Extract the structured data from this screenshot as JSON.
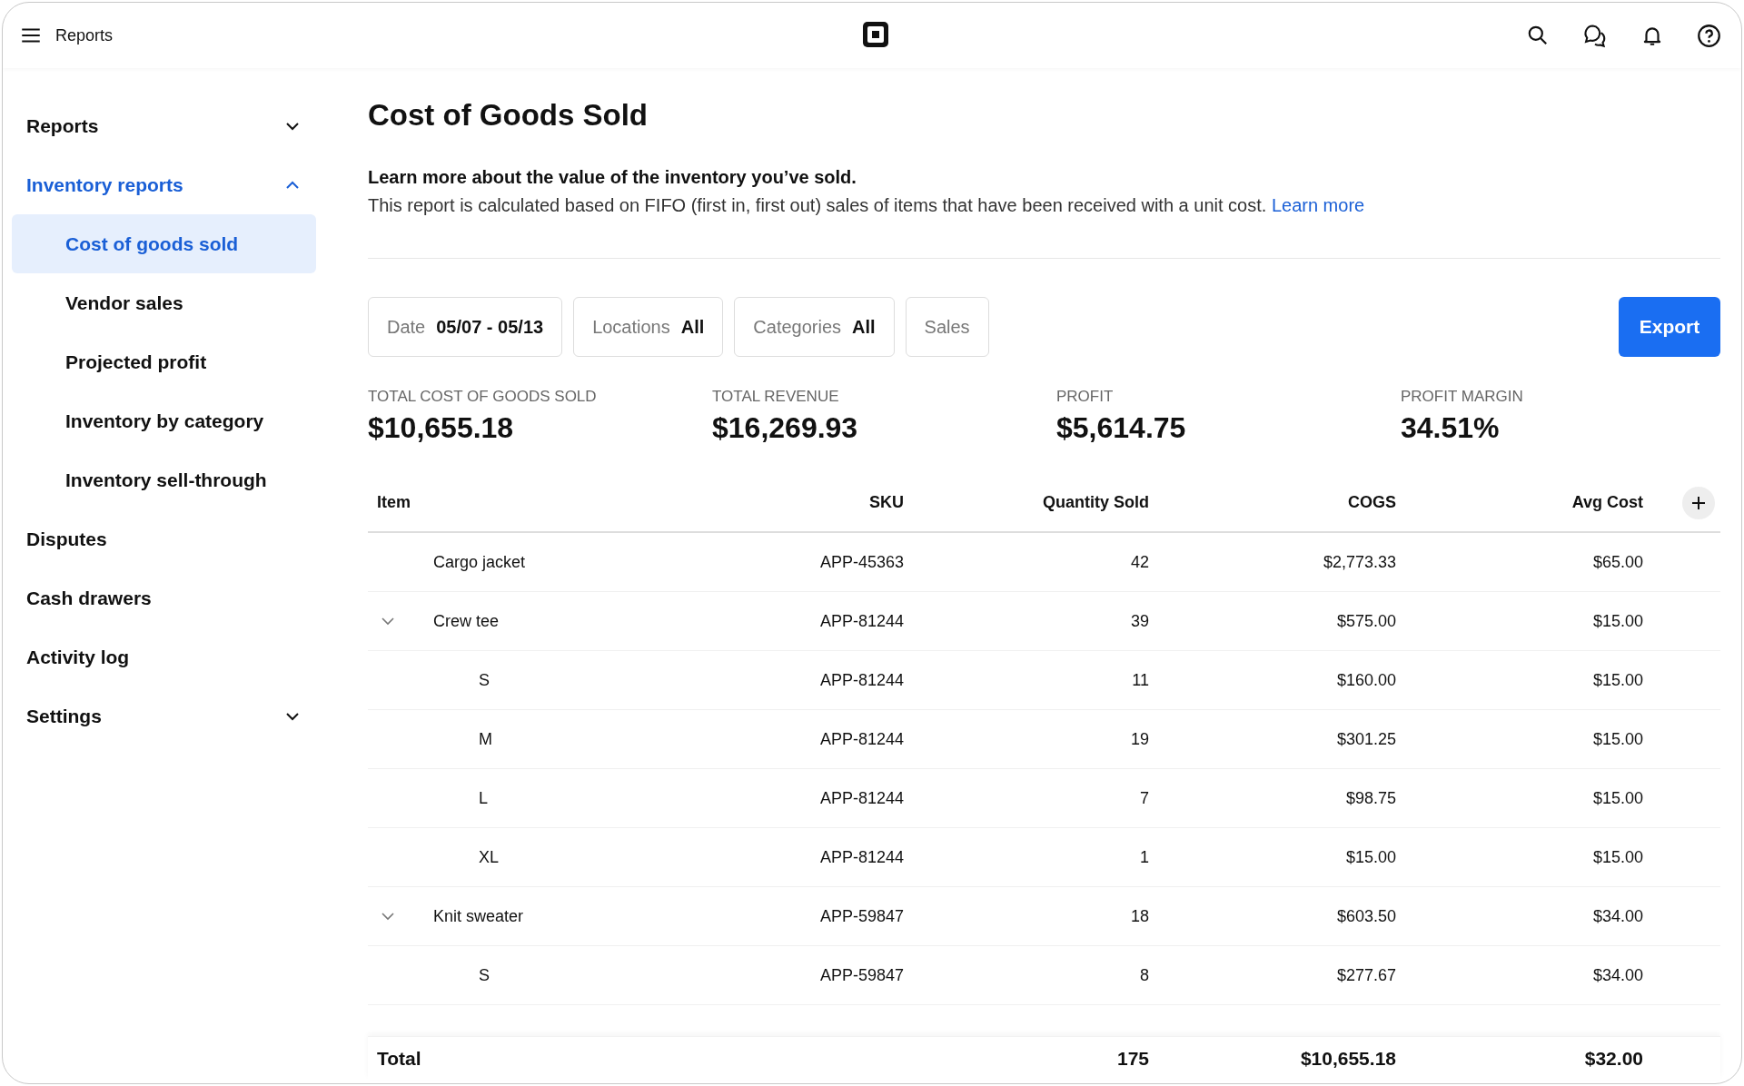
{
  "top_bar": {
    "title": "Reports"
  },
  "sidebar": {
    "items": [
      {
        "label": "Reports",
        "kind": "group",
        "expanded": false,
        "selected": false
      },
      {
        "label": "Inventory reports",
        "kind": "group",
        "expanded": true,
        "selected": true,
        "children": [
          {
            "label": "Cost of goods sold",
            "selected": true
          },
          {
            "label": "Vendor sales",
            "selected": false
          },
          {
            "label": "Projected profit",
            "selected": false
          },
          {
            "label": "Inventory by category",
            "selected": false
          },
          {
            "label": "Inventory sell-through",
            "selected": false
          }
        ]
      },
      {
        "label": "Disputes",
        "kind": "link",
        "selected": false
      },
      {
        "label": "Cash drawers",
        "kind": "link",
        "selected": false
      },
      {
        "label": "Activity log",
        "kind": "link",
        "selected": false
      },
      {
        "label": "Settings",
        "kind": "group",
        "expanded": false,
        "selected": false
      }
    ]
  },
  "page": {
    "title": "Cost of Goods Sold",
    "intro": "Learn more about the value of the inventory you’ve sold.",
    "description": "This report is calculated based on FIFO (first in, first out) sales of items that have been received with a unit cost.",
    "link": "Learn more"
  },
  "filters": [
    {
      "label": "Date",
      "value": "05/07 - 05/13"
    },
    {
      "label": "Locations",
      "value": "All"
    },
    {
      "label": "Categories",
      "value": "All"
    },
    {
      "label": "Sales"
    }
  ],
  "export_button": "Export",
  "stats": [
    {
      "label": "TOTAL COST OF GOODS SOLD",
      "value": "$10,655.18"
    },
    {
      "label": "TOTAL REVENUE",
      "value": "$16,269.93"
    },
    {
      "label": "PROFIT",
      "value": "$5,614.75"
    },
    {
      "label": "PROFIT MARGIN",
      "value": "34.51%"
    }
  ],
  "table": {
    "columns": [
      "Item",
      "SKU",
      "Quantity Sold",
      "COGS",
      "Avg Cost"
    ],
    "rows": [
      {
        "item": "Cargo jacket",
        "sku": "APP-45363",
        "quantity": "42",
        "cogs": "$2,773.33",
        "avg_cost": "$65.00"
      },
      {
        "item": "Crew tee",
        "sku": "APP-81244",
        "quantity": "39",
        "cogs": "$575.00",
        "avg_cost": "$15.00",
        "expanded": true,
        "children": [
          {
            "item": "S",
            "sku": "APP-81244",
            "quantity": "11",
            "cogs": "$160.00",
            "avg_cost": "$15.00"
          },
          {
            "item": "M",
            "sku": "APP-81244",
            "quantity": "19",
            "cogs": "$301.25",
            "avg_cost": "$15.00"
          },
          {
            "item": "L",
            "sku": "APP-81244",
            "quantity": "7",
            "cogs": "$98.75",
            "avg_cost": "$15.00"
          },
          {
            "item": "XL",
            "sku": "APP-81244",
            "quantity": "1",
            "cogs": "$15.00",
            "avg_cost": "$15.00"
          }
        ]
      },
      {
        "item": "Knit sweater",
        "sku": "APP-59847",
        "quantity": "18",
        "cogs": "$603.50",
        "avg_cost": "$34.00",
        "expanded": true,
        "children": [
          {
            "item": "S",
            "sku": "APP-59847",
            "quantity": "8",
            "cogs": "$277.67",
            "avg_cost": "$34.00"
          }
        ]
      }
    ],
    "total": {
      "label": "Total",
      "quantity": "175",
      "cogs": "$10,655.18",
      "avg_cost": "$32.00"
    }
  }
}
